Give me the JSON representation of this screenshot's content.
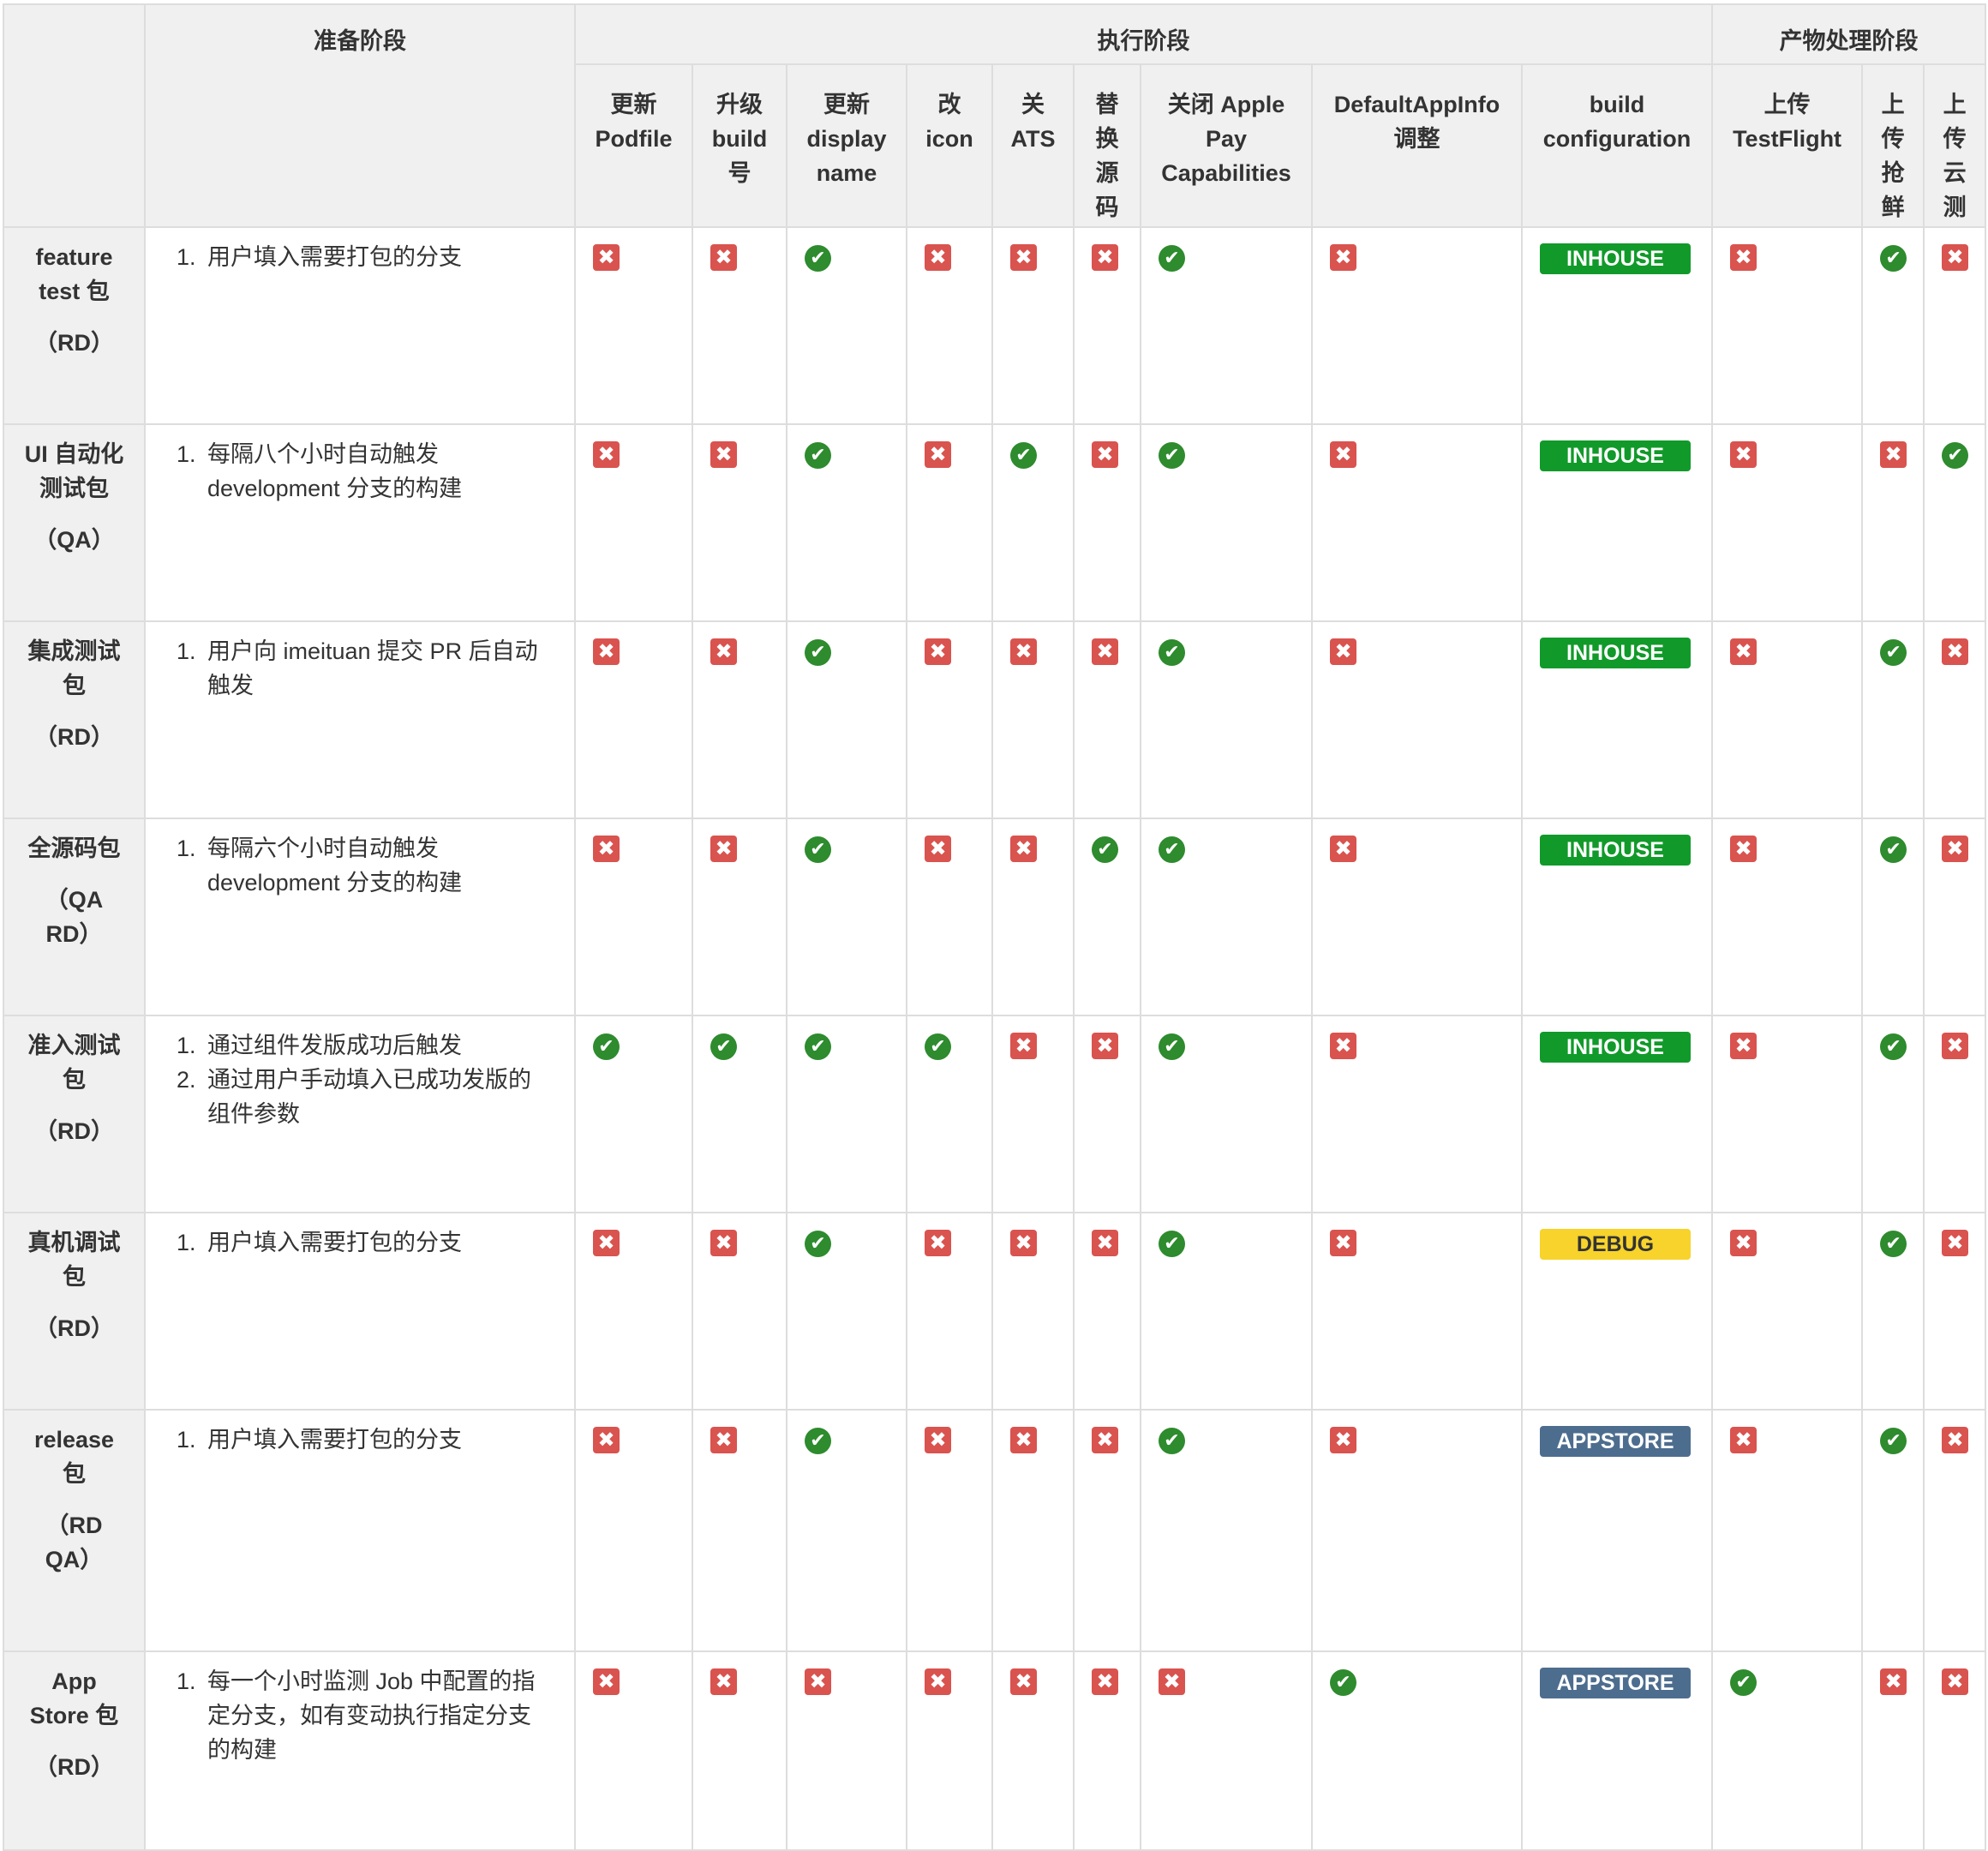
{
  "colors": {
    "header_bg": "#f0f0f0",
    "border": "#dddddd",
    "cross": "#d9534f",
    "check": "#2e8b2e",
    "inhouse": "#119a2a",
    "debug": "#f7d32c",
    "appstore": "#4d6d8f"
  },
  "header": {
    "groups": [
      "准备阶段",
      "执行阶段",
      "产物处理阶段"
    ],
    "columns": [
      "更新\nPodfile",
      "升级\nbuild\n号",
      "更新\ndisplay\nname",
      "改\nicon",
      "关\nATS",
      "替\n换\n源\n码",
      "关闭 Apple\nPay\nCapabilities",
      "DefaultAppInfo\n调整",
      "build\nconfiguration",
      "上传\nTestFlight",
      "上\n传\n抢\n鲜",
      "上\n传\n云\n测"
    ]
  },
  "rows": [
    {
      "name": "feature\ntest 包",
      "role": "（RD）",
      "steps": [
        "用户填入需要打包的分支"
      ],
      "marks": [
        "x",
        "x",
        "ok",
        "x",
        "x",
        "x",
        "ok",
        "x"
      ],
      "config": "INHOUSE",
      "config_style": "green",
      "post": [
        "x",
        "ok",
        "x"
      ]
    },
    {
      "name": "UI 自动化\n测试包",
      "role": "（QA）",
      "steps": [
        "每隔八个小时自动触发\ndevelopment 分支的构建"
      ],
      "marks": [
        "x",
        "x",
        "ok",
        "x",
        "ok",
        "x",
        "ok",
        "x"
      ],
      "config": "INHOUSE",
      "config_style": "green",
      "post": [
        "x",
        "x",
        "ok"
      ]
    },
    {
      "name": "集成测试\n包",
      "role": "（RD）",
      "steps": [
        "用户向 imeituan 提交 PR 后自动\n触发"
      ],
      "marks": [
        "x",
        "x",
        "ok",
        "x",
        "x",
        "x",
        "ok",
        "x"
      ],
      "config": "INHOUSE",
      "config_style": "green",
      "post": [
        "x",
        "ok",
        "x"
      ]
    },
    {
      "name": "全源码包",
      "role": "（QA\nRD）",
      "steps": [
        "每隔六个小时自动触发\ndevelopment 分支的构建"
      ],
      "marks": [
        "x",
        "x",
        "ok",
        "x",
        "x",
        "ok",
        "ok",
        "x"
      ],
      "config": "INHOUSE",
      "config_style": "green",
      "post": [
        "x",
        "ok",
        "x"
      ]
    },
    {
      "name": "准入测试\n包",
      "role": "（RD）",
      "steps": [
        "通过组件发版成功后触发",
        "通过用户手动填入已成功发版的\n组件参数"
      ],
      "marks": [
        "ok",
        "ok",
        "ok",
        "ok",
        "x",
        "x",
        "ok",
        "x"
      ],
      "config": "INHOUSE",
      "config_style": "green",
      "post": [
        "x",
        "ok",
        "x"
      ]
    },
    {
      "name": "真机调试\n包",
      "role": "（RD）",
      "steps": [
        "用户填入需要打包的分支"
      ],
      "marks": [
        "x",
        "x",
        "ok",
        "x",
        "x",
        "x",
        "ok",
        "x"
      ],
      "config": "DEBUG",
      "config_style": "yellow",
      "post": [
        "x",
        "ok",
        "x"
      ]
    },
    {
      "name": "release\n包",
      "role": "（RD\nQA）",
      "steps": [
        "用户填入需要打包的分支"
      ],
      "marks": [
        "x",
        "x",
        "ok",
        "x",
        "x",
        "x",
        "ok",
        "x"
      ],
      "config": "APPSTORE",
      "config_style": "blue",
      "post": [
        "x",
        "ok",
        "x"
      ]
    },
    {
      "name": "App\nStore 包",
      "role": "（RD）",
      "steps": [
        "每一个小时监测 Job 中配置的指\n定分支，如有变动执行指定分支\n的构建"
      ],
      "marks": [
        "x",
        "x",
        "x",
        "x",
        "x",
        "x",
        "x",
        "ok"
      ],
      "config": "APPSTORE",
      "config_style": "blue",
      "post": [
        "ok",
        "x",
        "x"
      ]
    }
  ]
}
